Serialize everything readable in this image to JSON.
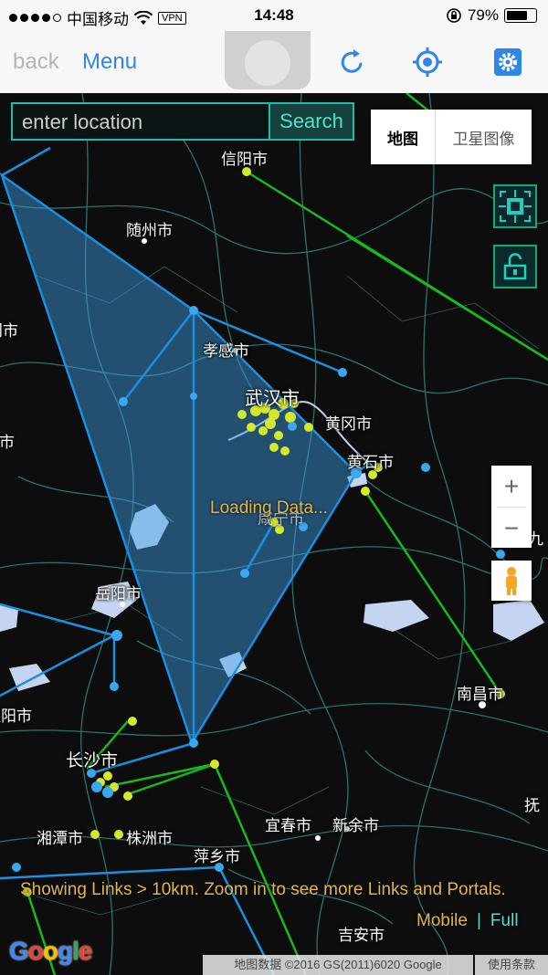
{
  "status_bar": {
    "carrier": "中国移动",
    "vpn": "VPN",
    "time": "14:48",
    "battery": "79%",
    "battery_fraction": 0.79
  },
  "nav": {
    "back_label": "back",
    "menu_label": "Menu",
    "icons": [
      "refresh-icon",
      "locate-icon",
      "settings-icon"
    ],
    "accent_color": "#2f86e8"
  },
  "search": {
    "placeholder": "enter location",
    "button_label": "Search"
  },
  "map_type": {
    "map_label": "地图",
    "satellite_label": "卫星图像",
    "selected": "地图"
  },
  "map_labels": {
    "xinyang": "信阳市",
    "suizhou": "随州市",
    "xiaogan": "孝感市",
    "wuhan": "武汉市",
    "huanggang": "黄冈市",
    "huangshi": "黄石市",
    "xianning": "咸宁市",
    "yueyang": "岳阳市",
    "nanchang": "南昌市",
    "changsha": "长沙市",
    "xiangtan": "湘潭市",
    "zhuzhou": "株洲市",
    "yichun": "宜春市",
    "xinyu": "新余市",
    "pingxiang": "萍乡市",
    "jian": "吉安市",
    "edge_left_1": "门市",
    "edge_left_2": "州市",
    "edge_left_3": "益阳市",
    "edge_right_1": "九",
    "edge_right_2": "抚"
  },
  "zoom": {
    "plus": "+",
    "minus": "−"
  },
  "overlay": {
    "loading": "Loading Data...",
    "info": "Showing Links > 10km. Zoom in to see more Links and Portals.",
    "mobile": "Mobile",
    "separator": "|",
    "full": "Full"
  },
  "footer": {
    "logo": "Google",
    "attribution": "地图数据 ©2016 GS(2011)6020 Google",
    "terms": "使用条款"
  },
  "colors": {
    "field_fill": "#3fa0e8",
    "link_blue": "#1b8fe0",
    "link_green": "#19b81e",
    "portal_yellow": "#d6e82a",
    "portal_blue": "#3aa8f0",
    "text_gold": "#e2b648",
    "text_cyan": "#4fe0d0"
  }
}
